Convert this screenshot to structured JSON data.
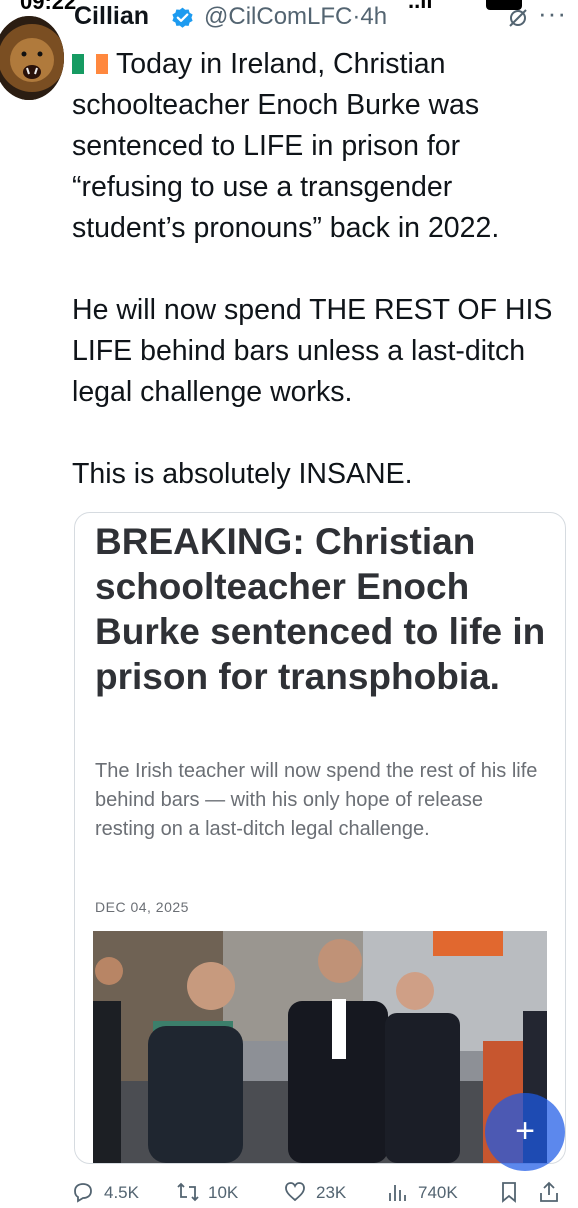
{
  "status_bar": {
    "time": "09:22",
    "signal": "..ll"
  },
  "tweet": {
    "author_name": "Cillian",
    "handle": "@CilComLFC",
    "separator": "·",
    "time_ago": "4h",
    "flag_icon": "ireland-flag-icon",
    "paragraphs": [
      "Today in Ireland, Christian schoolteacher Enoch Burke was sentenced to LIFE in prison for “refusing to use a transgender student’s pronouns” back in 2022.",
      "He will now spend THE REST OF HIS LIFE behind bars unless a last-ditch legal challenge works.",
      "This is absolutely INSANE."
    ]
  },
  "card": {
    "headline": "BREAKING: Christian schoolteacher Enoch Burke sentenced to life in prison for transphobia.",
    "subheadline": "The Irish teacher will now spend the rest of his life behind bars — with his only hope of release resting on a last-ditch legal challenge.",
    "date": "DEC 04, 2025"
  },
  "actions": {
    "replies": "4.5K",
    "reposts": "10K",
    "likes": "23K",
    "views": "740K"
  },
  "colors": {
    "accent": "#1d9bf0",
    "verified": "#1d9bf0",
    "muted_text": "#536471",
    "flag_green": "#169b62",
    "flag_orange": "#ff883e"
  }
}
